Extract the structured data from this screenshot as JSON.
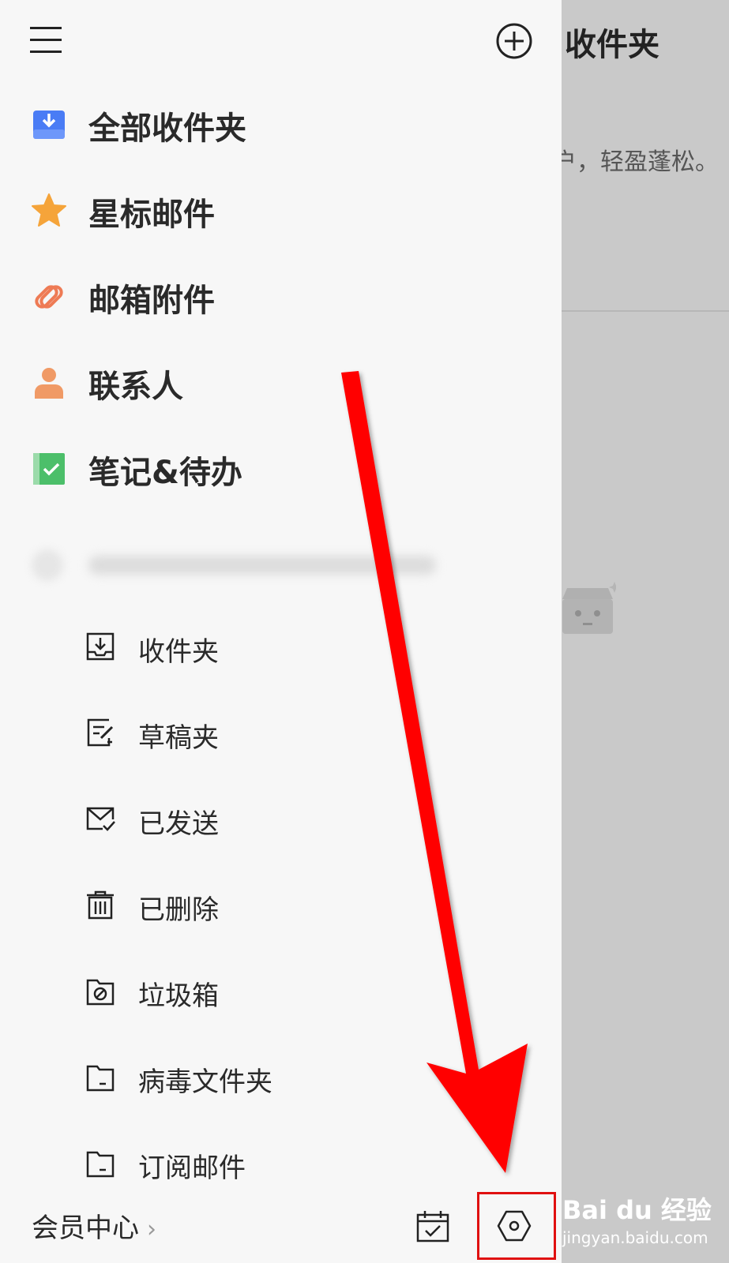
{
  "main": {
    "title": "收件夹",
    "tip_text": "户，轻盈蓬松。"
  },
  "drawer": {
    "primary_items": [
      {
        "label": "全部收件夹",
        "icon": "all-inboxes-icon",
        "color": "#4a7cf5"
      },
      {
        "label": "星标邮件",
        "icon": "star-icon",
        "color": "#f5a43a"
      },
      {
        "label": "邮箱附件",
        "icon": "attachment-icon",
        "color": "#ee7b55"
      },
      {
        "label": "联系人",
        "icon": "contact-icon",
        "color": "#f09a66"
      },
      {
        "label": "笔记&待办",
        "icon": "notes-todo-icon",
        "color": "#4cbf6a"
      }
    ],
    "folders": [
      {
        "label": "收件夹",
        "icon": "inbox-tray-icon"
      },
      {
        "label": "草稿夹",
        "icon": "draft-icon"
      },
      {
        "label": "已发送",
        "icon": "sent-mail-icon"
      },
      {
        "label": "已删除",
        "icon": "trash-icon"
      },
      {
        "label": "垃圾箱",
        "icon": "spam-folder-icon"
      },
      {
        "label": "病毒文件夹",
        "icon": "virus-folder-icon"
      },
      {
        "label": "订阅邮件",
        "icon": "subscription-folder-icon"
      }
    ],
    "bottom": {
      "vip_label": "会员中心",
      "vip_chevron": "›"
    }
  },
  "watermark": {
    "brand": "Bai du 经验",
    "site": "jingyan.baidu.com"
  },
  "colors": {
    "highlight": "#e01010",
    "arrow": "#ff0000"
  }
}
